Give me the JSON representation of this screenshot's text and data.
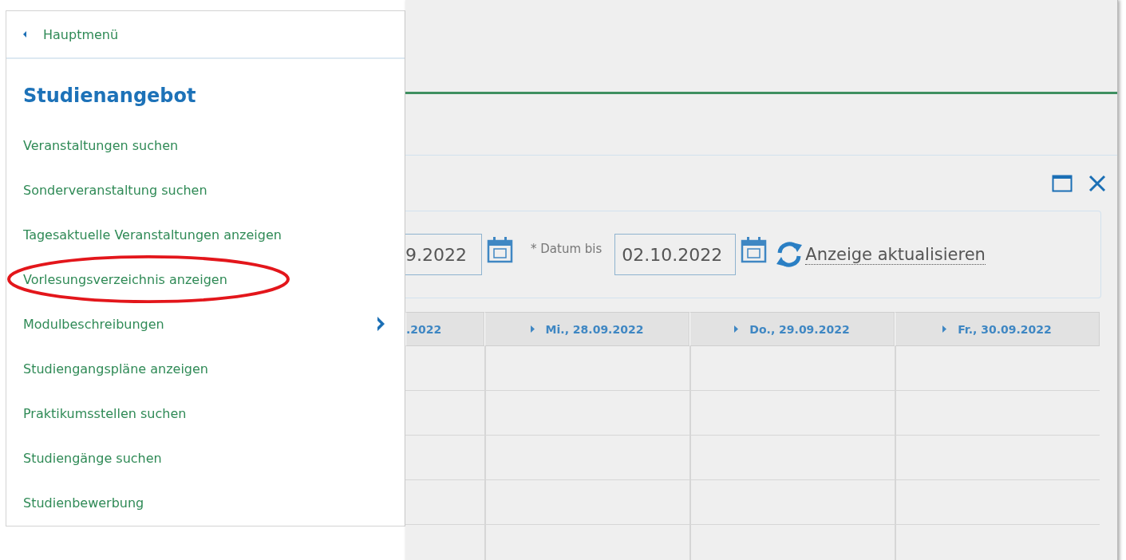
{
  "menu": {
    "back_label": "Hauptmenü",
    "title": "Studienangebot",
    "items": [
      {
        "label": "Veranstaltungen suchen",
        "submenu": false,
        "circled": false
      },
      {
        "label": "Sonderveranstaltung suchen",
        "submenu": false,
        "circled": false
      },
      {
        "label": "Tagesaktuelle Veranstaltungen anzeigen",
        "submenu": false,
        "circled": false
      },
      {
        "label": "Vorlesungsverzeichnis anzeigen",
        "submenu": false,
        "circled": true
      },
      {
        "label": "Modulbeschreibungen",
        "submenu": true,
        "circled": false
      },
      {
        "label": "Studiengangspläne anzeigen",
        "submenu": false,
        "circled": false
      },
      {
        "label": "Praktikumsstellen suchen",
        "submenu": false,
        "circled": false
      },
      {
        "label": "Studiengänge suchen",
        "submenu": false,
        "circled": false
      },
      {
        "label": "Studienbewerbung",
        "submenu": false,
        "circled": false
      }
    ]
  },
  "filter": {
    "date_from": "9.2022",
    "date_to_label": "* Datum bis",
    "date_to": "02.10.2022",
    "refresh_link": "Anzeige aktualisieren"
  },
  "calendar": {
    "columns": [
      {
        "label": ".2022",
        "arrow": false
      },
      {
        "label": "Mi., 28.09.2022",
        "arrow": true
      },
      {
        "label": "Do., 29.09.2022",
        "arrow": true
      },
      {
        "label": "Fr., 30.09.2022",
        "arrow": true
      }
    ]
  }
}
